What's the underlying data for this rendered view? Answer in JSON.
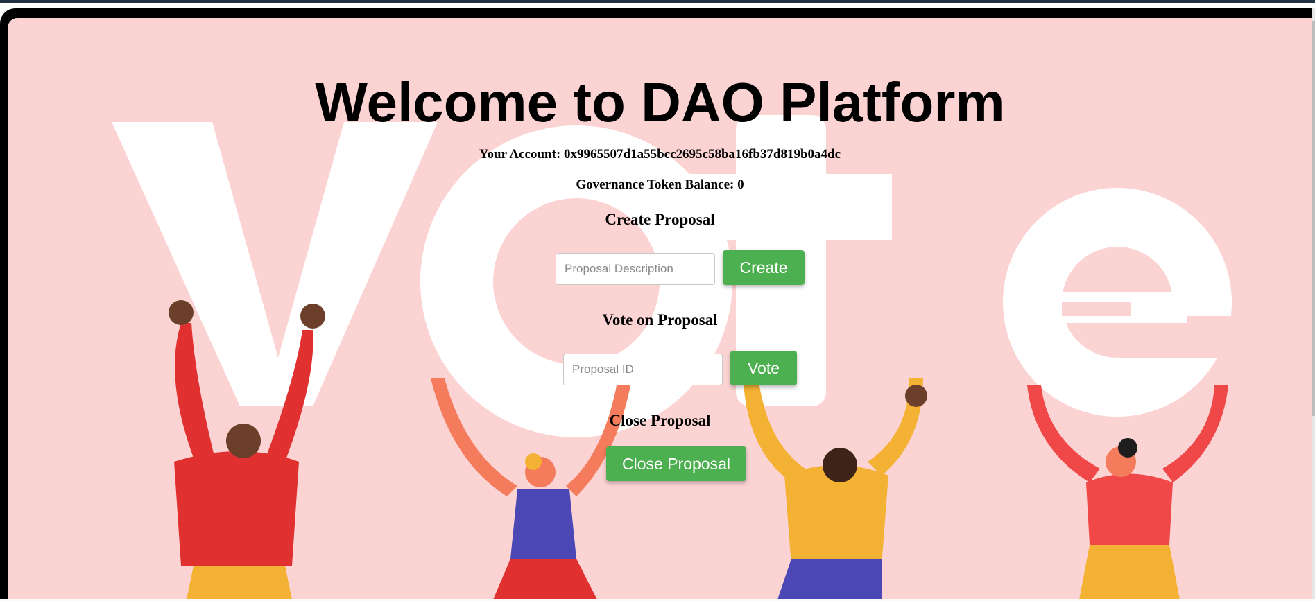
{
  "page": {
    "title": "Welcome to DAO Platform",
    "account_line": "Your Account: 0x9965507d1a55bcc2695c58ba16fb37d819b0a4dc",
    "balance_line": "Governance Token Balance: 0"
  },
  "create_section": {
    "heading": "Create Proposal",
    "description_placeholder": "Proposal Description",
    "button_label": "Create"
  },
  "vote_section": {
    "heading": "Vote on Proposal",
    "id_placeholder": "Proposal ID",
    "button_label": "Vote"
  },
  "close_section": {
    "heading": "Close Proposal",
    "button_label": "Close Proposal"
  },
  "background": {
    "word": "Vote",
    "colors": {
      "panel": "#fcd3d3",
      "letters": "#ffffff",
      "button": "#4caf50"
    }
  }
}
